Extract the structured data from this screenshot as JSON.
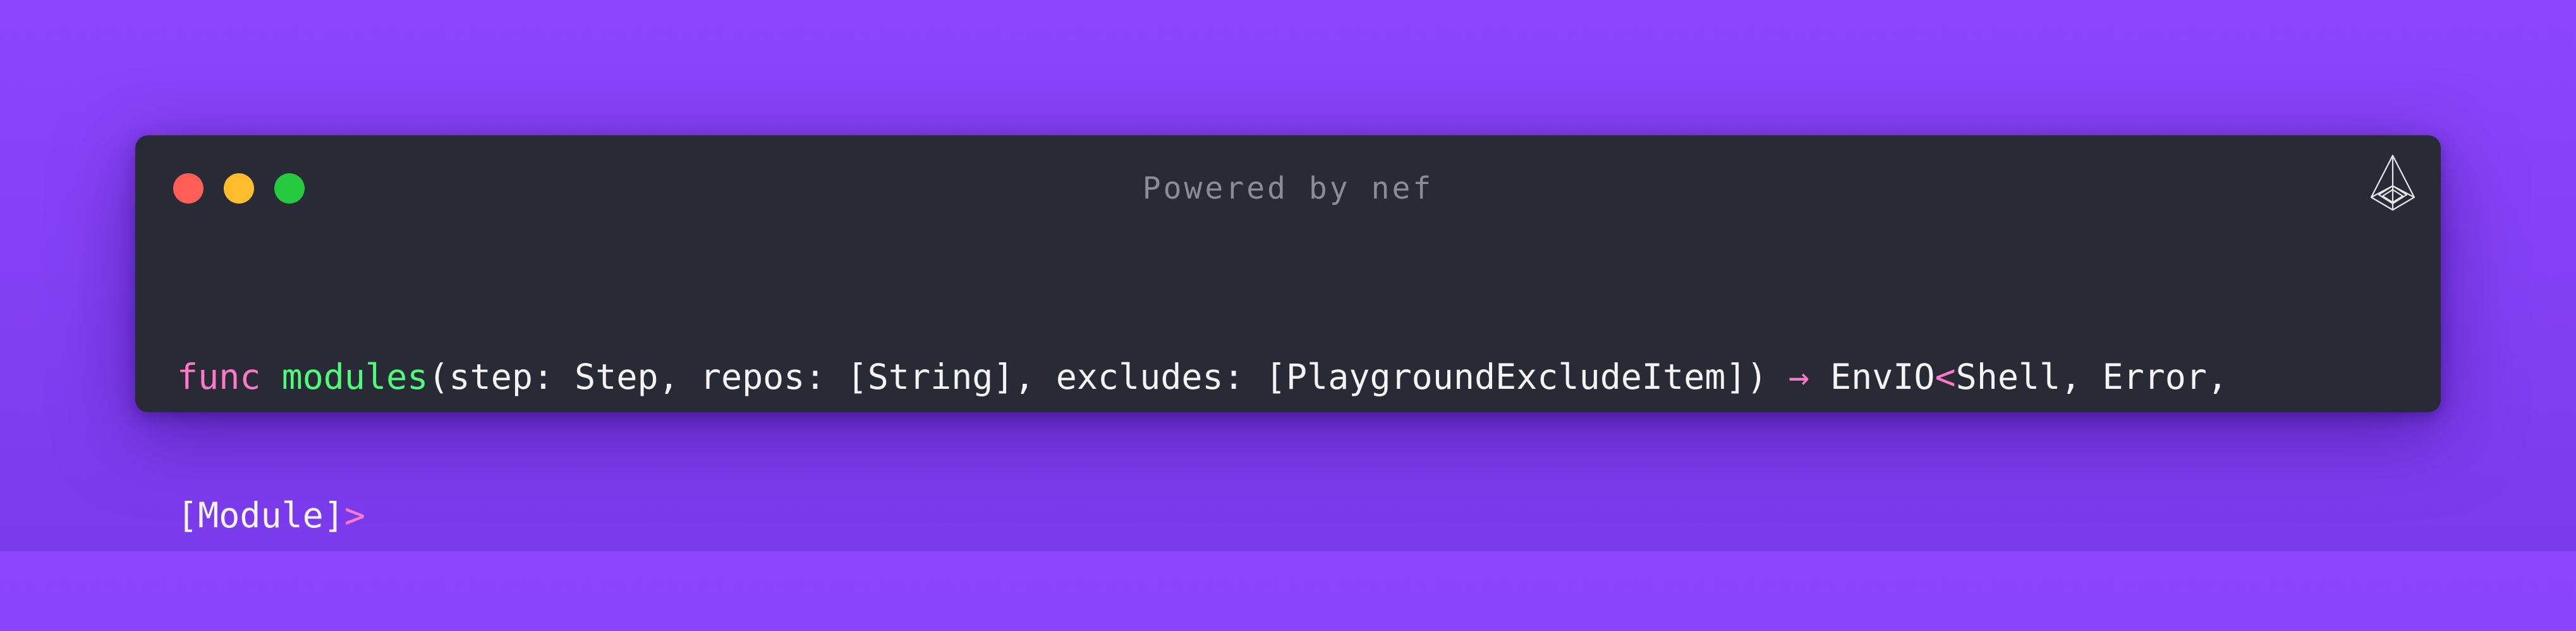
{
  "window": {
    "title": "Powered by nef",
    "logo_icon": "nef-logo-icon",
    "traffic_lights": [
      "close",
      "minimize",
      "maximize"
    ],
    "colors": {
      "close": "#ff5f56",
      "minimize": "#ffbd2e",
      "maximize": "#27c93f"
    }
  },
  "code": {
    "line1": {
      "keyword": "func",
      "function": "modules",
      "params": "(step: Step, repos: [String], excludes: [PlaygroundExcludeItem])",
      "arrow": "→",
      "return_type": "EnvIO",
      "generic_open": "<",
      "generic_args": "Shell, Error,"
    },
    "line2": {
      "continuation": "[Module]",
      "generic_close": ">"
    }
  },
  "colors": {
    "background": "#8c45fb",
    "window_bg": "#282a36",
    "keyword": "#ff79c6",
    "function": "#50fa7b",
    "text": "#f4f4f5",
    "title": "#8a8d98"
  }
}
